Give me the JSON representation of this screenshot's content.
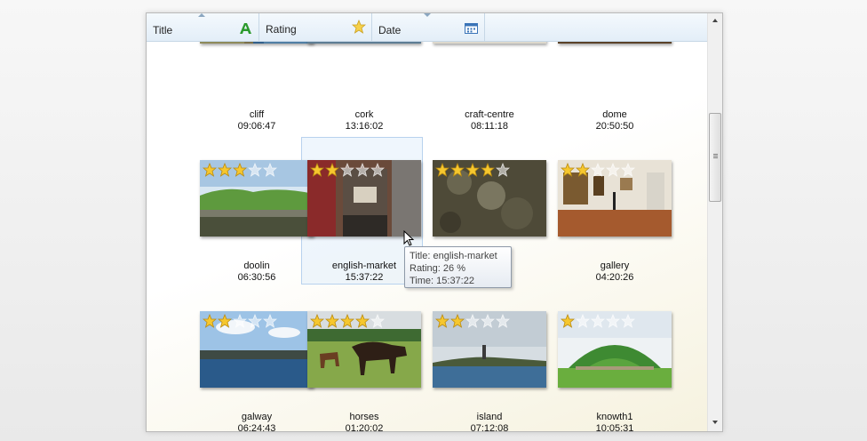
{
  "columns": [
    {
      "label": "Title",
      "icon": "letter-a-icon"
    },
    {
      "label": "Rating",
      "icon": "star-icon"
    },
    {
      "label": "Date",
      "icon": "calendar-icon"
    }
  ],
  "items": [
    {
      "title": "cliff",
      "time": "09:06:47",
      "rating": 0,
      "scene": "cliff"
    },
    {
      "title": "cork",
      "time": "13:16:02",
      "rating": 0,
      "scene": "cork"
    },
    {
      "title": "craft-centre",
      "time": "08:11:18",
      "rating": 0,
      "scene": "craft"
    },
    {
      "title": "dome",
      "time": "20:50:50",
      "rating": 0,
      "scene": "dome"
    },
    {
      "title": "doolin",
      "time": "06:30:56",
      "rating": 3,
      "scene": "doolin"
    },
    {
      "title": "english-market",
      "time": "15:37:22",
      "rating": 2,
      "scene": "market"
    },
    {
      "title": "",
      "time": "",
      "rating": 4,
      "scene": "stone"
    },
    {
      "title": "gallery",
      "time": "04:20:26",
      "rating": 2,
      "scene": "gallery"
    },
    {
      "title": "galway",
      "time": "06:24:43",
      "rating": 2,
      "scene": "galway"
    },
    {
      "title": "horses",
      "time": "01:20:02",
      "rating": 4,
      "scene": "horses"
    },
    {
      "title": "island",
      "time": "07:12:08",
      "rating": 2,
      "scene": "island"
    },
    {
      "title": "knowth1",
      "time": "10:05:31",
      "rating": 1,
      "scene": "knowth"
    }
  ],
  "tooltip": {
    "title": "Title:  english-market",
    "rating": "Rating:  26 %",
    "time": "Time:  15:37:22"
  }
}
